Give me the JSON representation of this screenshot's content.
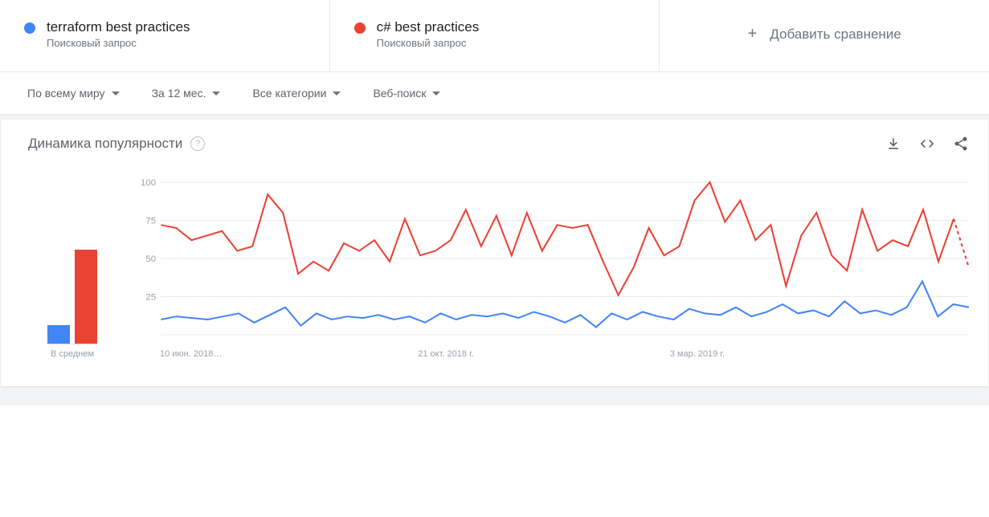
{
  "compare": {
    "term1": {
      "label": "terraform best practices",
      "sub": "Поисковый запрос",
      "color": "#4285f4"
    },
    "term2": {
      "label": "c# best practices",
      "sub": "Поисковый запрос",
      "color": "#ea4335"
    },
    "add": "Добавить сравнение"
  },
  "filters": {
    "region": "По всему миру",
    "period": "За 12 мес.",
    "category": "Все категории",
    "type": "Веб-поиск"
  },
  "panel": {
    "title": "Динамика популярности"
  },
  "avg": {
    "label": "В среднем",
    "blue": 12,
    "red": 62
  },
  "xlabels": {
    "l1": "10 июн. 2018…",
    "l2": "21 окт. 2018 г.",
    "l3": "3 мар. 2019 г."
  },
  "yticks": [
    "25",
    "50",
    "75",
    "100"
  ],
  "chart_data": {
    "type": "line",
    "title": "Динамика популярности",
    "ylabel": "",
    "xlabel": "",
    "ylim": [
      0,
      100
    ],
    "x_tick_labels": [
      "10 июн. 2018…",
      "21 окт. 2018 г.",
      "3 мар. 2019 г."
    ],
    "series": [
      {
        "name": "terraform best practices",
        "color": "#4285f4",
        "average": 12,
        "values": [
          10,
          12,
          11,
          10,
          12,
          14,
          8,
          13,
          18,
          6,
          14,
          10,
          12,
          11,
          13,
          10,
          12,
          8,
          14,
          10,
          13,
          12,
          14,
          11,
          15,
          12,
          8,
          13,
          5,
          14,
          10,
          15,
          12,
          10,
          17,
          14,
          13,
          18,
          12,
          15,
          20,
          14,
          16,
          12,
          22,
          14,
          16,
          13,
          18,
          35,
          12,
          20,
          18
        ]
      },
      {
        "name": "c# best practices",
        "color": "#ea4335",
        "average": 62,
        "values": [
          72,
          70,
          62,
          65,
          68,
          55,
          58,
          92,
          80,
          40,
          48,
          42,
          60,
          55,
          62,
          48,
          76,
          52,
          55,
          62,
          82,
          58,
          78,
          52,
          80,
          55,
          72,
          70,
          72,
          48,
          26,
          44,
          70,
          52,
          58,
          88,
          100,
          74,
          88,
          62,
          72,
          32,
          65,
          80,
          52,
          42,
          82,
          55,
          62,
          58,
          82,
          48,
          76,
          44
        ]
      }
    ]
  }
}
